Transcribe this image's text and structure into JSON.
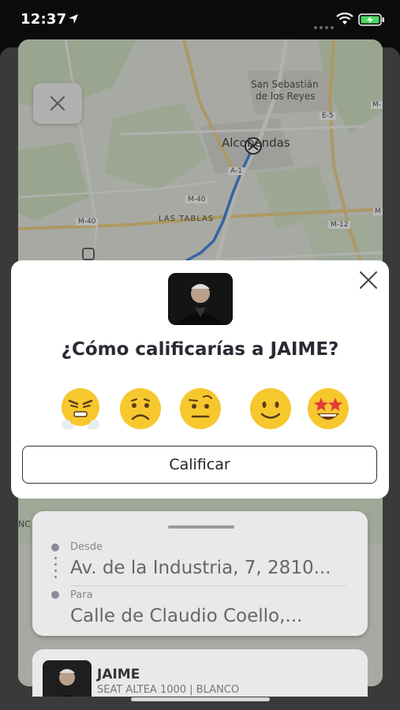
{
  "status_bar": {
    "time": "12:37"
  },
  "map": {
    "labels": {
      "san_sebastian": "San Sebastián",
      "de_los_reyes": "de los Reyes",
      "alcobendas": "Alcobendas",
      "las_tablas": "LAS TABLAS",
      "m40_a": "M-40",
      "m40_b": "M-40",
      "a1": "A-1",
      "e5": "E-5",
      "m12": "M-12",
      "m_top": "M-",
      "m_mid": "M",
      "nc": "NC"
    }
  },
  "rating_modal": {
    "question": "¿Cómo calificarías a JAIME?",
    "options": [
      "very-angry",
      "sad",
      "skeptical",
      "smile",
      "star-struck"
    ],
    "button_label": "Calificar"
  },
  "trip": {
    "from_label": "Desde",
    "from_address": "Av. de la Industria, 7, 2810...",
    "to_label": "Para",
    "to_address": "Calle de Claudio Coello,..."
  },
  "driver": {
    "name": "JAIME",
    "car": "SEAT ALTEA 1000 | BLANCO"
  },
  "colors": {
    "route": "#4a8be0",
    "modal_bg": "#ffffff",
    "text_dark": "#2a2a34"
  }
}
